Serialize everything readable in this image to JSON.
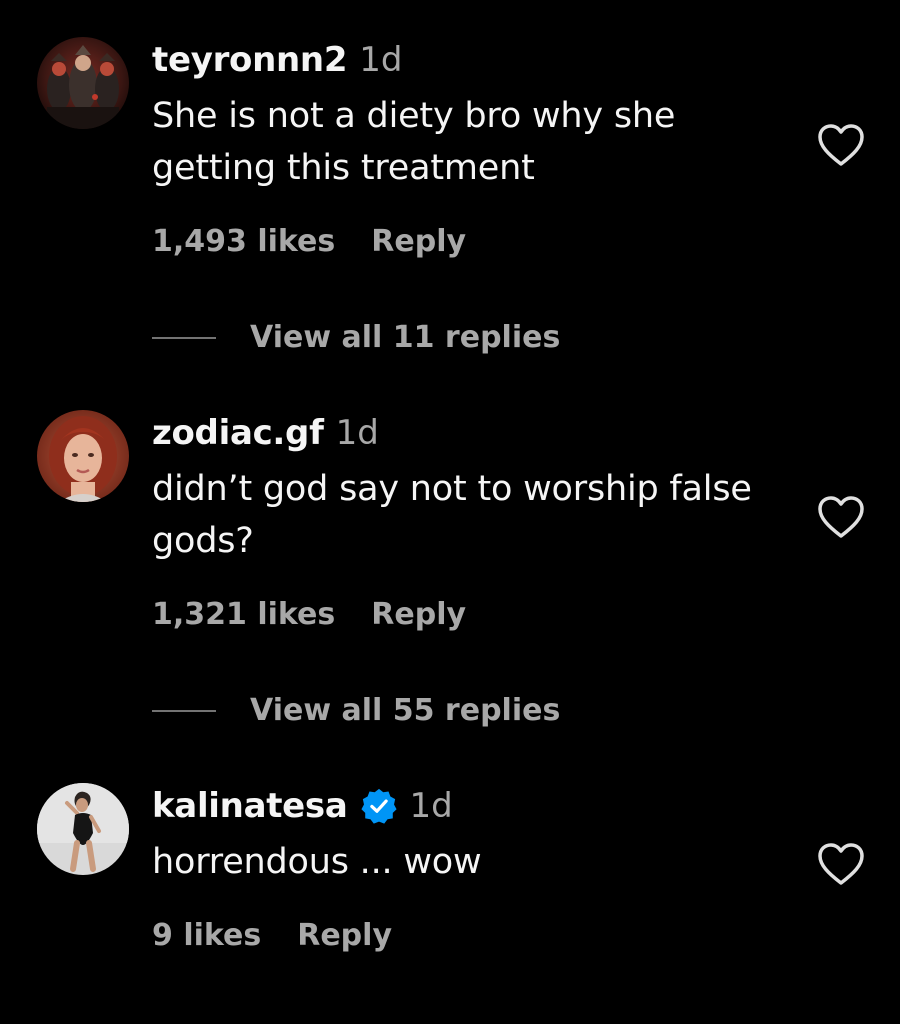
{
  "comments": [
    {
      "username": "teyronnn2",
      "time": "1d",
      "verified": false,
      "text_lines": [
        "She is not a diety bro why she",
        "getting this treatment"
      ],
      "likes": "1,493 likes",
      "reply_label": "Reply",
      "view_replies": "View all 11 replies",
      "avatar_icon": "samurai-group-avatar"
    },
    {
      "username": "zodiac.gf",
      "time": "1d",
      "verified": false,
      "text_lines": [
        "didn’t god say not to worship false",
        "gods?"
      ],
      "likes": "1,321 likes",
      "reply_label": "Reply",
      "view_replies": "View all 55 replies",
      "avatar_icon": "red-haired-woman-avatar"
    },
    {
      "username": "kalinatesa",
      "time": "1d",
      "verified": true,
      "text_lines": [
        "horrendous ... wow"
      ],
      "likes": "9 likes",
      "reply_label": "Reply",
      "avatar_icon": "woman-swimsuit-avatar"
    }
  ],
  "colors": {
    "background": "#000000",
    "primary_text": "#f5f5f5",
    "secondary_text": "#a8a8a8",
    "verified_blue": "#0095f6"
  }
}
